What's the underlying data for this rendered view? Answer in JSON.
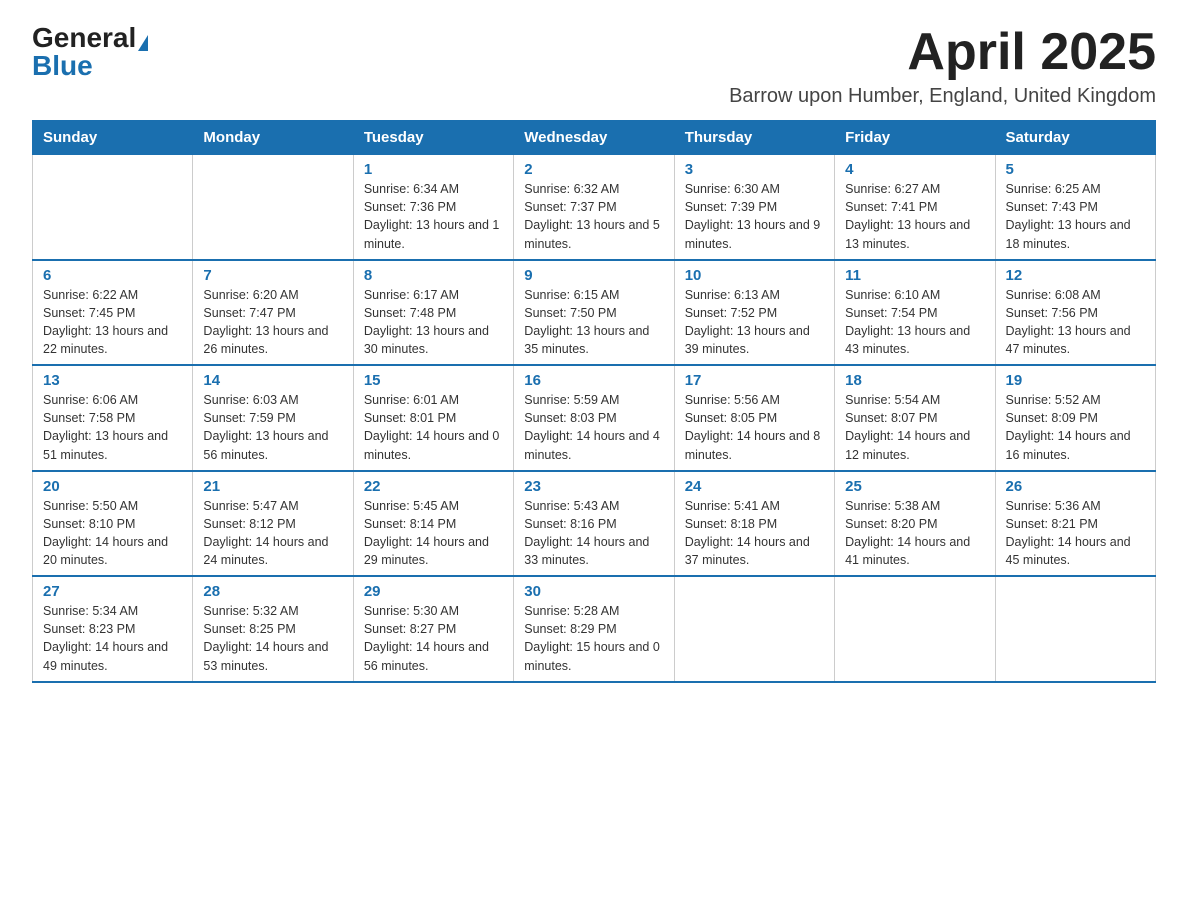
{
  "logo": {
    "general": "General",
    "blue": "Blue"
  },
  "header": {
    "month_title": "April 2025",
    "location": "Barrow upon Humber, England, United Kingdom"
  },
  "days_of_week": [
    "Sunday",
    "Monday",
    "Tuesday",
    "Wednesday",
    "Thursday",
    "Friday",
    "Saturday"
  ],
  "weeks": [
    [
      {
        "day": "",
        "info": ""
      },
      {
        "day": "",
        "info": ""
      },
      {
        "day": "1",
        "info": "Sunrise: 6:34 AM\nSunset: 7:36 PM\nDaylight: 13 hours and 1 minute."
      },
      {
        "day": "2",
        "info": "Sunrise: 6:32 AM\nSunset: 7:37 PM\nDaylight: 13 hours and 5 minutes."
      },
      {
        "day": "3",
        "info": "Sunrise: 6:30 AM\nSunset: 7:39 PM\nDaylight: 13 hours and 9 minutes."
      },
      {
        "day": "4",
        "info": "Sunrise: 6:27 AM\nSunset: 7:41 PM\nDaylight: 13 hours and 13 minutes."
      },
      {
        "day": "5",
        "info": "Sunrise: 6:25 AM\nSunset: 7:43 PM\nDaylight: 13 hours and 18 minutes."
      }
    ],
    [
      {
        "day": "6",
        "info": "Sunrise: 6:22 AM\nSunset: 7:45 PM\nDaylight: 13 hours and 22 minutes."
      },
      {
        "day": "7",
        "info": "Sunrise: 6:20 AM\nSunset: 7:47 PM\nDaylight: 13 hours and 26 minutes."
      },
      {
        "day": "8",
        "info": "Sunrise: 6:17 AM\nSunset: 7:48 PM\nDaylight: 13 hours and 30 minutes."
      },
      {
        "day": "9",
        "info": "Sunrise: 6:15 AM\nSunset: 7:50 PM\nDaylight: 13 hours and 35 minutes."
      },
      {
        "day": "10",
        "info": "Sunrise: 6:13 AM\nSunset: 7:52 PM\nDaylight: 13 hours and 39 minutes."
      },
      {
        "day": "11",
        "info": "Sunrise: 6:10 AM\nSunset: 7:54 PM\nDaylight: 13 hours and 43 minutes."
      },
      {
        "day": "12",
        "info": "Sunrise: 6:08 AM\nSunset: 7:56 PM\nDaylight: 13 hours and 47 minutes."
      }
    ],
    [
      {
        "day": "13",
        "info": "Sunrise: 6:06 AM\nSunset: 7:58 PM\nDaylight: 13 hours and 51 minutes."
      },
      {
        "day": "14",
        "info": "Sunrise: 6:03 AM\nSunset: 7:59 PM\nDaylight: 13 hours and 56 minutes."
      },
      {
        "day": "15",
        "info": "Sunrise: 6:01 AM\nSunset: 8:01 PM\nDaylight: 14 hours and 0 minutes."
      },
      {
        "day": "16",
        "info": "Sunrise: 5:59 AM\nSunset: 8:03 PM\nDaylight: 14 hours and 4 minutes."
      },
      {
        "day": "17",
        "info": "Sunrise: 5:56 AM\nSunset: 8:05 PM\nDaylight: 14 hours and 8 minutes."
      },
      {
        "day": "18",
        "info": "Sunrise: 5:54 AM\nSunset: 8:07 PM\nDaylight: 14 hours and 12 minutes."
      },
      {
        "day": "19",
        "info": "Sunrise: 5:52 AM\nSunset: 8:09 PM\nDaylight: 14 hours and 16 minutes."
      }
    ],
    [
      {
        "day": "20",
        "info": "Sunrise: 5:50 AM\nSunset: 8:10 PM\nDaylight: 14 hours and 20 minutes."
      },
      {
        "day": "21",
        "info": "Sunrise: 5:47 AM\nSunset: 8:12 PM\nDaylight: 14 hours and 24 minutes."
      },
      {
        "day": "22",
        "info": "Sunrise: 5:45 AM\nSunset: 8:14 PM\nDaylight: 14 hours and 29 minutes."
      },
      {
        "day": "23",
        "info": "Sunrise: 5:43 AM\nSunset: 8:16 PM\nDaylight: 14 hours and 33 minutes."
      },
      {
        "day": "24",
        "info": "Sunrise: 5:41 AM\nSunset: 8:18 PM\nDaylight: 14 hours and 37 minutes."
      },
      {
        "day": "25",
        "info": "Sunrise: 5:38 AM\nSunset: 8:20 PM\nDaylight: 14 hours and 41 minutes."
      },
      {
        "day": "26",
        "info": "Sunrise: 5:36 AM\nSunset: 8:21 PM\nDaylight: 14 hours and 45 minutes."
      }
    ],
    [
      {
        "day": "27",
        "info": "Sunrise: 5:34 AM\nSunset: 8:23 PM\nDaylight: 14 hours and 49 minutes."
      },
      {
        "day": "28",
        "info": "Sunrise: 5:32 AM\nSunset: 8:25 PM\nDaylight: 14 hours and 53 minutes."
      },
      {
        "day": "29",
        "info": "Sunrise: 5:30 AM\nSunset: 8:27 PM\nDaylight: 14 hours and 56 minutes."
      },
      {
        "day": "30",
        "info": "Sunrise: 5:28 AM\nSunset: 8:29 PM\nDaylight: 15 hours and 0 minutes."
      },
      {
        "day": "",
        "info": ""
      },
      {
        "day": "",
        "info": ""
      },
      {
        "day": "",
        "info": ""
      }
    ]
  ]
}
